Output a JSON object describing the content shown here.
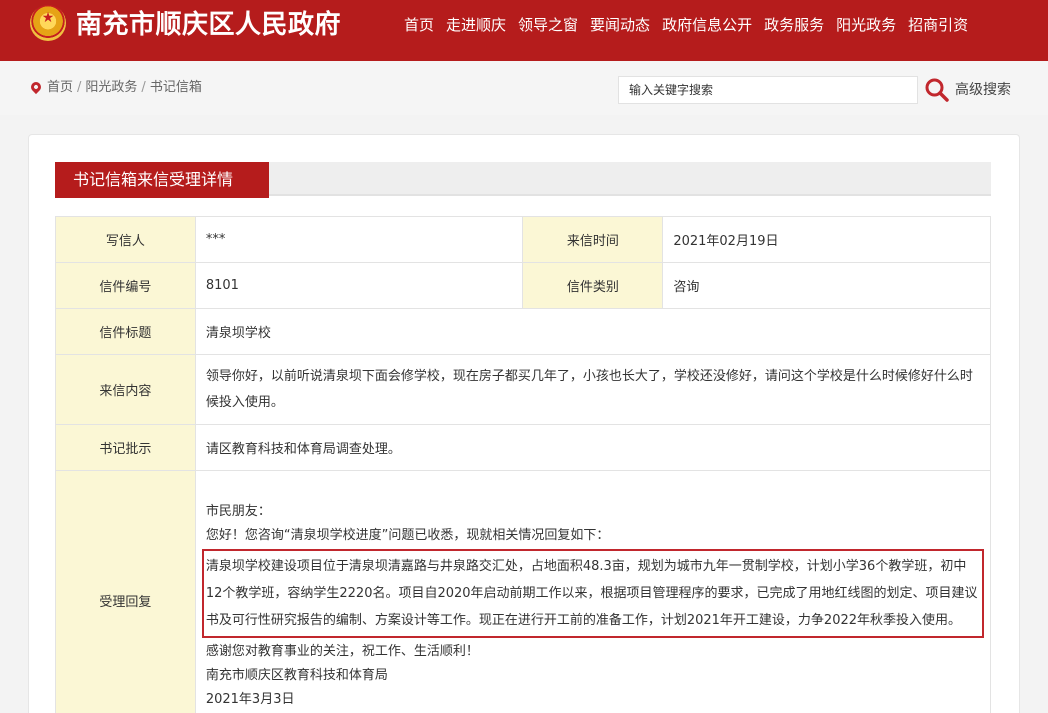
{
  "header": {
    "site_title": "南充市顺庆区人民政府",
    "nav": [
      "首页",
      "走进顺庆",
      "领导之窗",
      "要闻动态",
      "政府信息公开",
      "政务服务",
      "阳光政务",
      "招商引资"
    ]
  },
  "breadcrumb": {
    "items": [
      "首页",
      "阳光政务",
      "书记信箱"
    ],
    "separator": "/"
  },
  "search": {
    "placeholder": "输入关键字搜索",
    "advanced_label": "高级搜索"
  },
  "section": {
    "title": "书记信箱来信受理详情"
  },
  "detail": {
    "writer_label": "写信人",
    "writer": "***",
    "date_label": "来信时间",
    "date": "2021年02月19日",
    "number_label": "信件编号",
    "number": "8101",
    "category_label": "信件类别",
    "category": "咨询",
    "subject_label": "信件标题",
    "subject": "清泉坝学校",
    "content_label": "来信内容",
    "content": "领导你好，以前听说清泉坝下面会修学校，现在房子都买几年了，小孩也长大了，学校还没修好，请问这个学校是什么时候修好什么时候投入使用。",
    "instruction_label": "书记批示",
    "instruction": "请区教育科技和体育局调查处理。",
    "reply_label": "受理回复",
    "reply": {
      "greeting": "市民朋友：",
      "intro": "您好！您咨询“清泉坝学校进度”问题已收悉，现就相关情况回复如下：",
      "highlight": "清泉坝学校建设项目位于清泉坝清嘉路与井泉路交汇处，占地面积48.3亩，规划为城市九年一贯制学校，计划小学36个教学班，初中12个教学班，容纳学生2220名。项目自2020年启动前期工作以来，根据项目管理程序的要求，已完成了用地红线图的划定、项目建议书及可行性研究报告的编制、方案设计等工作。现正在进行开工前的准备工作，计划2021年开工建设，力争2022年秋季投入使用。",
      "thanks": "感谢您对教育事业的关注，祝工作、生活顺利！",
      "signer": "南充市顺庆区教育科技和体育局",
      "sign_date": "2021年3月3日"
    }
  },
  "colors": {
    "brand_red": "#b51c1c",
    "label_bg": "#fbf7d5",
    "highlight_border": "#c1272d"
  }
}
